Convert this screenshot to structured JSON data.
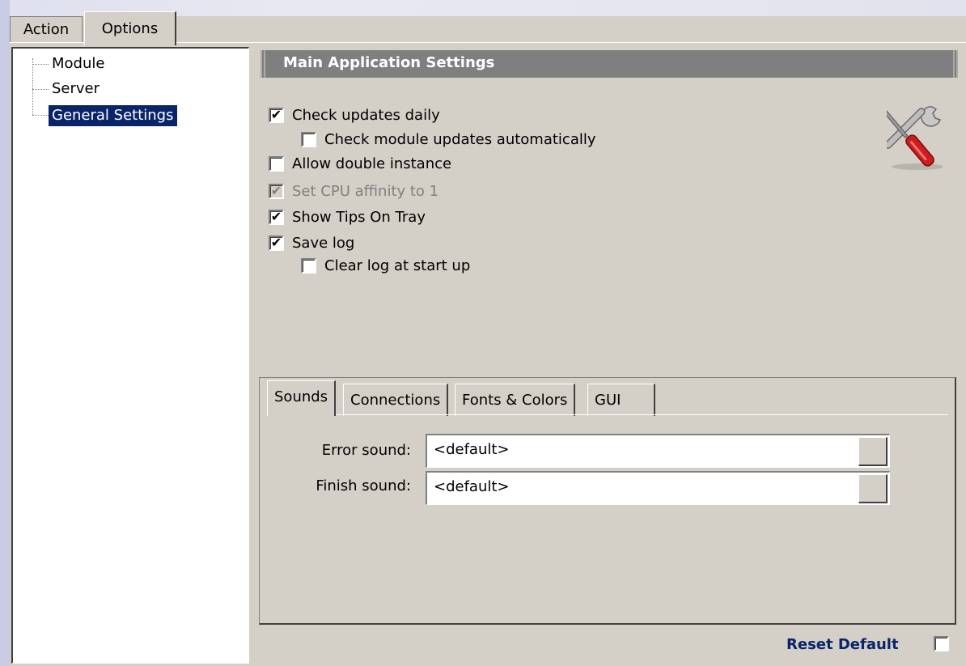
{
  "tabs": {
    "action": "Action",
    "options": "Options"
  },
  "tree": {
    "items": [
      "Module",
      "Server",
      "General Settings"
    ],
    "selected": "General Settings"
  },
  "header": {
    "title": "Main Application Settings"
  },
  "options": [
    {
      "label": "Check updates daily",
      "checked": true,
      "enabled": true
    },
    {
      "label": "Check module updates automatically",
      "checked": false,
      "enabled": true
    },
    {
      "label": "Allow double instance",
      "checked": false,
      "enabled": true
    },
    {
      "label": "Set CPU affinity to 1",
      "checked": true,
      "enabled": false
    },
    {
      "label": "Show Tips On Tray",
      "checked": true,
      "enabled": true
    },
    {
      "label": "Save log",
      "checked": true,
      "enabled": true
    },
    {
      "label": "Clear log at start up",
      "checked": false,
      "enabled": true
    }
  ],
  "subtabs": [
    "Sounds",
    "Connections",
    "Fonts & Colors",
    "GUI"
  ],
  "sounds": {
    "error_label": "Error sound:",
    "error_value": "<default>",
    "finish_label": "Finish sound:",
    "finish_value": "<default>"
  },
  "footer": {
    "reset_label": "Reset Default",
    "reset_checked": false
  },
  "icons": {
    "settings": "tools-icon",
    "check": "checkmark-icon"
  }
}
